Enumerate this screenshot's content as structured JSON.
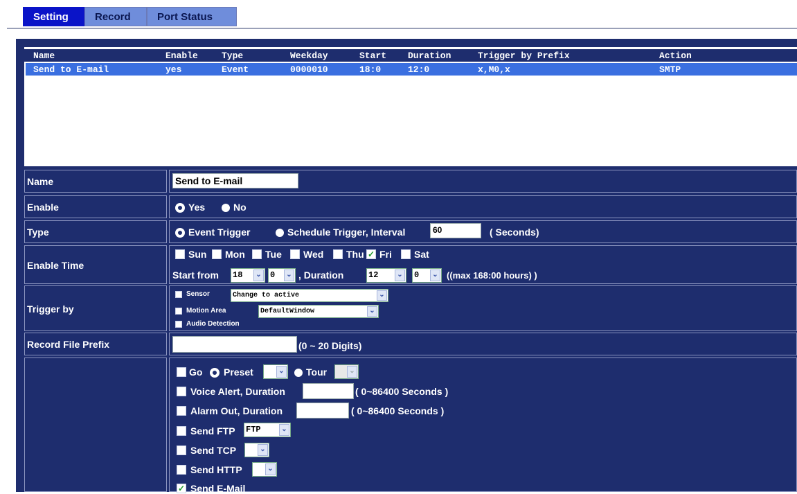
{
  "tabs": [
    "Setting",
    "Record",
    "Port Status"
  ],
  "list": {
    "headers": [
      "Name",
      "Enable",
      "Type",
      "Weekday",
      "Start",
      "Duration",
      "Trigger by Prefix",
      "Action"
    ],
    "rows": [
      [
        "Send to E-mail",
        "yes",
        "Event",
        "0000010",
        "18:0",
        "12:0",
        "x,M0,x",
        "SMTP"
      ]
    ]
  },
  "name": {
    "label": "Name",
    "value": "Send to E-mail"
  },
  "enable": {
    "label": "Enable",
    "yes": "Yes",
    "no": "No",
    "selected": "Yes"
  },
  "type": {
    "label": "Type",
    "event": "Event Trigger",
    "schedule": "Schedule Trigger, Interval",
    "interval": "60",
    "unit": "( Seconds)",
    "selected": "Event Trigger"
  },
  "enable_time": {
    "label": "Enable Time",
    "days": [
      {
        "label": "Sun",
        "checked": false
      },
      {
        "label": "Mon",
        "checked": false
      },
      {
        "label": "Tue",
        "checked": false
      },
      {
        "label": "Wed",
        "checked": false
      },
      {
        "label": "Thu",
        "checked": false
      },
      {
        "label": "Fri",
        "checked": true
      },
      {
        "label": "Sat",
        "checked": false
      }
    ],
    "start_from": "Start from",
    "start_hour": "18",
    "start_min": "0",
    "duration_label": ", Duration",
    "dur_hour": "12",
    "dur_min": "0",
    "max_note": "((max 168:00 hours) )"
  },
  "trigger": {
    "label": "Trigger by",
    "sensor": "Sensor",
    "sensor_value": "Change to active",
    "motion": "Motion Area",
    "motion_value": "DefaultWindow",
    "audio": "Audio Detection"
  },
  "prefix": {
    "label": "Record File Prefix",
    "value": "",
    "hint": "(0 ~ 20 Digits)"
  },
  "action": {
    "go": "Go",
    "preset": "Preset",
    "tour": "Tour",
    "voice": "Voice Alert, Duration",
    "voice_hint": "( 0~86400 Seconds )",
    "alarm": "Alarm Out, Duration",
    "alarm_hint": "( 0~86400 Seconds )",
    "ftp": "Send FTP",
    "ftp_value": "FTP",
    "tcp": "Send TCP",
    "http": "Send HTTP",
    "email": "Send E-Mail",
    "email_checked": true
  },
  "arrow_glyph": "⌄",
  "check_glyph": "✓"
}
